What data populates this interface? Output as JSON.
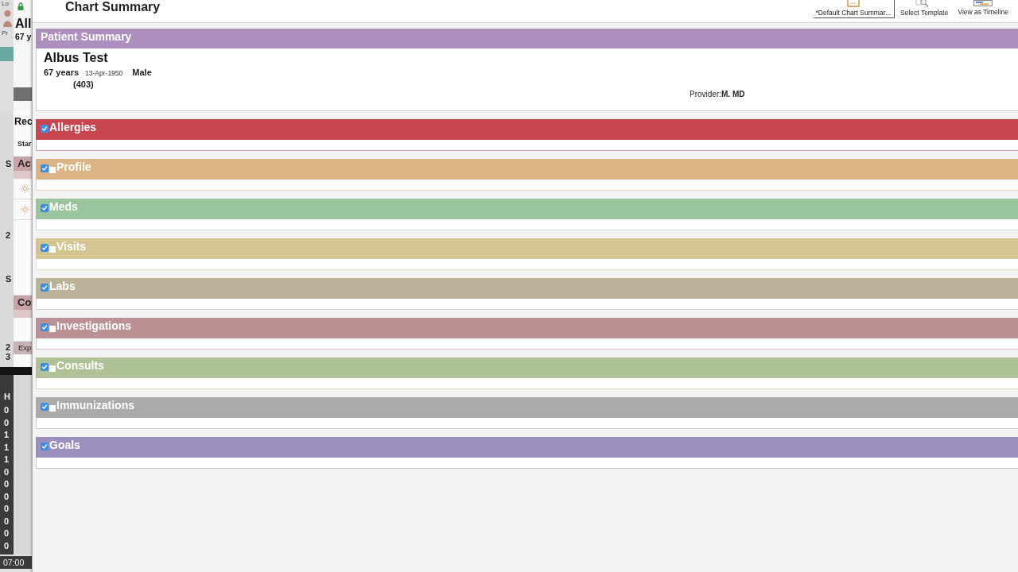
{
  "background_window": {
    "top_label": "Lo",
    "profile_label": "Pr",
    "patient_name": "All",
    "patient_age": "67 y",
    "records_title": "Rec",
    "start_label": "Star",
    "panels": [
      {
        "title": "Ac",
        "kind": "activity"
      },
      {
        "title": "Co",
        "kind": "plain"
      }
    ],
    "expand_label": "Exp",
    "rail_marks": [
      "S",
      "2",
      "S",
      "2",
      "3"
    ],
    "schedule": {
      "heading": "H",
      "hours": [
        "0",
        "0",
        "1",
        "1",
        "1",
        "0",
        "0",
        "0",
        "0",
        "0",
        "0",
        "0"
      ],
      "footer": "07:00"
    }
  },
  "window": {
    "title": "Chart Summary"
  },
  "toolbar": [
    {
      "label": "*Default Chart Summar...",
      "kind": "document",
      "selected": true
    },
    {
      "label": "Select Template",
      "kind": "magnifier",
      "selected": false
    },
    {
      "label": "View as Timeline",
      "kind": "timeline",
      "selected": false
    }
  ],
  "patient_summary": {
    "title": "Patient Summary",
    "name": "Albus Test",
    "age": "67 years",
    "birth_date": "13-Apr-1950",
    "sex": "Male",
    "code": "(403)",
    "provider": "Provider:**M. MD**"
  },
  "sections": [
    {
      "title": "Allergies",
      "color": "#c8464f",
      "checkboxes": [
        {
          "checked": true
        }
      ]
    },
    {
      "title": "Profile",
      "color": "#dbb385",
      "checkboxes": [
        {
          "checked": true
        },
        {
          "checked": false
        }
      ]
    },
    {
      "title": "Meds",
      "color": "#99c49c",
      "checkboxes": [
        {
          "checked": true
        }
      ]
    },
    {
      "title": "Visits",
      "color": "#d4c492",
      "checkboxes": [
        {
          "checked": true
        },
        {
          "checked": false
        }
      ]
    },
    {
      "title": "Labs",
      "color": "#bcb298",
      "checkboxes": [
        {
          "checked": true
        }
      ]
    },
    {
      "title": "Investigations",
      "color": "#bc9194",
      "checkboxes": [
        {
          "checked": true
        },
        {
          "checked": false
        }
      ]
    },
    {
      "title": "Consults",
      "color": "#aec296",
      "checkboxes": [
        {
          "checked": true
        },
        {
          "checked": false
        }
      ]
    },
    {
      "title": "Immunizations",
      "color": "#aaaaaa",
      "checkboxes": [
        {
          "checked": true
        },
        {
          "checked": false
        }
      ]
    },
    {
      "title": "Goals",
      "color": "#9c8fbd",
      "checkboxes": [
        {
          "checked": true
        }
      ]
    }
  ]
}
